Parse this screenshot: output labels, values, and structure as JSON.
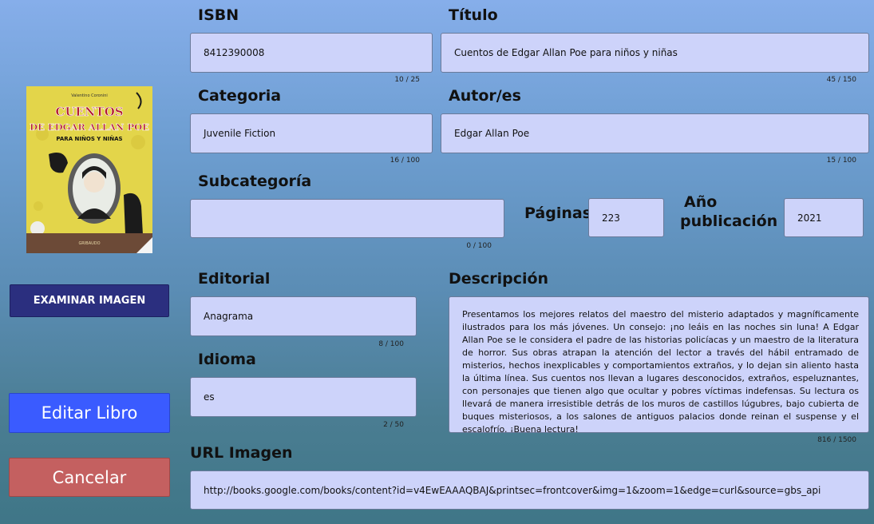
{
  "cover": {
    "author_small": "Valentino Coronini",
    "title_line1": "CUENTOS",
    "title_line2": "DE EDGAR ALLAN POE",
    "title_line3": "PARA NIÑOS Y NIÑAS",
    "publisher_small": "GRIBAUDO"
  },
  "buttons": {
    "browse": "EXAMINAR IMAGEN",
    "edit": "Editar Libro",
    "cancel": "Cancelar"
  },
  "fields": {
    "isbn": {
      "label": "ISBN",
      "value": "8412390008",
      "counter": "10 / 25"
    },
    "title": {
      "label": "Título",
      "value": "Cuentos de Edgar Allan Poe para niños y niñas",
      "counter": "45 / 150"
    },
    "category": {
      "label": "Categoria",
      "value": "Juvenile Fiction",
      "counter": "16 / 100"
    },
    "authors": {
      "label": "Autor/es",
      "value": "Edgar Allan Poe",
      "counter": "15 / 100"
    },
    "subcategory": {
      "label": "Subcategoría",
      "value": "",
      "counter": "0 / 100"
    },
    "pages": {
      "label": "Páginas",
      "value": "223"
    },
    "year": {
      "label_line1": "Año",
      "label_line2": "publicación",
      "value": "2021"
    },
    "publisher": {
      "label": "Editorial",
      "value": "Anagrama",
      "counter": "8 / 100"
    },
    "language": {
      "label": "Idioma",
      "value": "es",
      "counter": "2 / 50"
    },
    "description": {
      "label": "Descripción",
      "value": "Presentamos los mejores relatos del maestro del misterio adaptados y magníficamente ilustrados para los más jóvenes. Un consejo: ¡no leáis en las noches sin luna! A Edgar Allan Poe se le considera el padre de las historias policíacas y un maestro de la literatura de horror. Sus obras atrapan la atención del lector a través del hábil entramado de misterios, hechos inexplicables y comportamientos extraños, y lo dejan sin aliento hasta la última línea. Sus cuentos nos llevan a lugares desconocidos, extraños, espeluznantes, con personajes que tienen algo que ocultar y pobres víctimas indefensas. Su lectura os llevará de manera irresistible detrás de los muros de castillos lúgubres, bajo cubierta de buques misteriosos, a los salones de antiguos palacios donde reinan el suspense y el escalofrío. ¡Buena lectura!",
      "counter": "816 / 1500"
    },
    "image_url": {
      "label": "URL Imagen",
      "value": "http://books.google.com/books/content?id=v4EwEAAAQBAJ&printsec=frontcover&img=1&zoom=1&edge=curl&source=gbs_api"
    }
  },
  "colors": {
    "field_bg": "#cdd3fa",
    "browse_btn": "#2b2f7f",
    "edit_btn": "#3a5bff",
    "cancel_btn": "#c46060"
  }
}
